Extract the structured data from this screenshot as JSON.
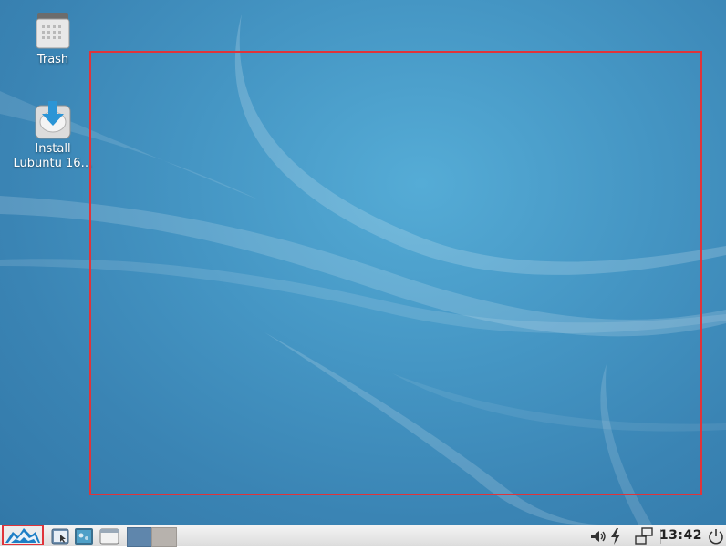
{
  "desktop": {
    "icons": [
      {
        "label": "Trash"
      },
      {
        "label": "Install\nLubuntu 16…"
      }
    ]
  },
  "taskbar": {
    "clock": "13:42",
    "pager": {
      "desktops": 2,
      "active_index": 0
    },
    "icons": {
      "start": "lubuntu-menu-icon",
      "file_manager": "file-manager-icon",
      "show_desktop": "show-desktop-icon",
      "window_list": "window-icon",
      "volume": "volume-icon",
      "power": "power-icon",
      "network": "network-icon",
      "shutdown": "shutdown-icon"
    }
  },
  "colors": {
    "desktop_bg": "#4596c4",
    "annotation": "#e0343a",
    "taskbar_bg": "#e6e6e6"
  }
}
